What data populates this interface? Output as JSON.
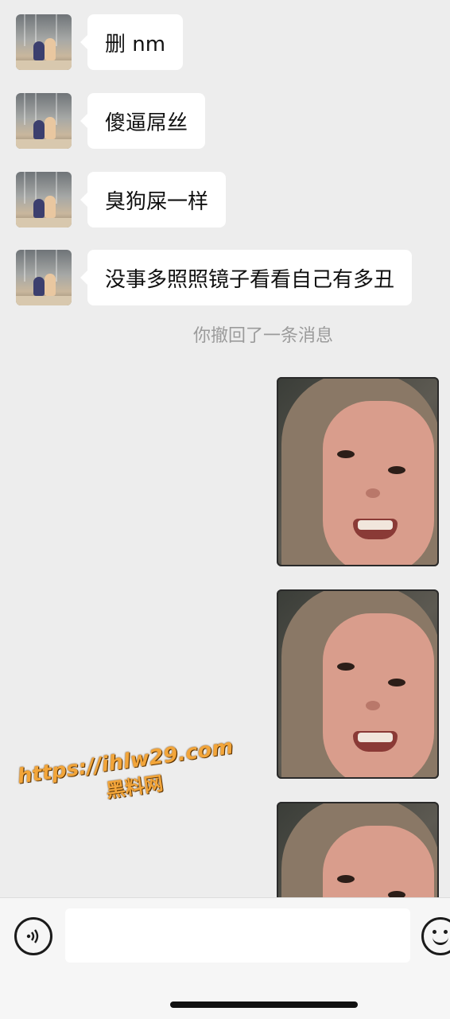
{
  "messages": [
    {
      "text": "删 nm"
    },
    {
      "text": "傻逼屌丝"
    },
    {
      "text": "臭狗屎一样"
    },
    {
      "text": "没事多照照镜子看看自己有多丑"
    }
  ],
  "system_note": "你撤回了一条消息",
  "watermark": {
    "url": "https://ihlw29.com",
    "name": "黑料网"
  },
  "input": {
    "placeholder": ""
  },
  "icons": {
    "voice": "voice-icon",
    "emoji": "emoji-icon"
  },
  "colors": {
    "background": "#ededed",
    "bubble_in": "#ffffff",
    "watermark": "#f2a53a"
  }
}
